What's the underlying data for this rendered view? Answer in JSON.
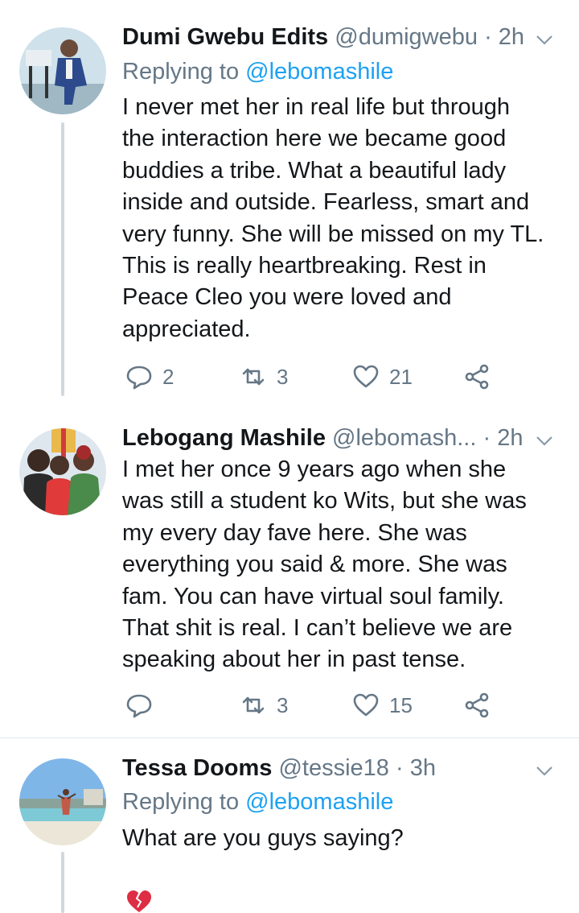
{
  "tweets": [
    {
      "name": "Dumi Gwebu Edits",
      "handle": "@dumigwebu",
      "time": "2h",
      "replying_prefix": "Replying to ",
      "replying_to": "@lebomashile",
      "lines": [
        "I never met her in real life but through",
        "the interaction here we became good",
        "buddies a tribe. What a beautiful lady",
        "inside and outside. Fearless, smart and",
        "very funny. She will be missed on my TL.",
        "This is really heartbreaking. Rest in",
        "Peace Cleo you were loved and",
        "appreciated."
      ],
      "replies": "2",
      "retweets": "3",
      "likes": "21"
    },
    {
      "name": "Lebogang Mashile",
      "handle": "@lebomash...",
      "time": "2h",
      "lines": [
        "I met her once 9 years ago when she",
        "was still a student ko Wits, but she was",
        "my every day fave here. She was",
        "everything you said & more. She was",
        "fam. You can have virtual soul family.",
        "That shit is real. I can’t believe we are",
        "speaking about her in past tense."
      ],
      "replies": "",
      "retweets": "3",
      "likes": "15"
    },
    {
      "name": "Tessa Dooms",
      "handle": "@tessie18",
      "time": "3h",
      "replying_prefix": "Replying to ",
      "replying_to": "@lebomashile",
      "lines": [
        "What are you guys saying?"
      ]
    }
  ],
  "separator": " · ",
  "icons": {
    "reply": "reply-icon",
    "retweet": "retweet-icon",
    "like": "heart-icon",
    "share": "share-icon",
    "caret": "chevron-down-icon",
    "emoji": "broken-heart-emoji"
  },
  "colors": {
    "accent": "#1da1f2",
    "muted": "#657786",
    "text": "#14171a",
    "line": "#cfd9de"
  }
}
